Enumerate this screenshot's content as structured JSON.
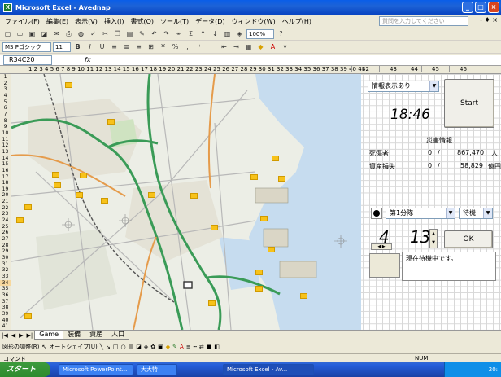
{
  "window": {
    "title": "Microsoft Excel - Avednap",
    "app_icon": "X"
  },
  "menu": {
    "items": [
      "ファイル(F)",
      "編集(E)",
      "表示(V)",
      "挿入(I)",
      "書式(O)",
      "ツール(T)",
      "データ(D)",
      "ウィンドウ(W)",
      "ヘルプ(H)"
    ],
    "help_placeholder": "質問を入力してください",
    "mdi": "- ♦ ×"
  },
  "toolbar": {
    "zoom": "100%",
    "font_name": "MS Pゴシック",
    "font_size": "11"
  },
  "namebox": {
    "cell": "R34C20",
    "fx": "fx"
  },
  "columns": {
    "narrow_numbers": "1 2 3 4 5 6 7 8 9 10 11 12 13 14 15 16 17 18 19 20 21 22 23 24 25 26 27 28 29 30 31 32 33 34 35 36 37 38 39 40 41",
    "wide": [
      "42",
      "43",
      "44",
      "45",
      "46"
    ]
  },
  "rows": [
    "1",
    "2",
    "3",
    "4",
    "5",
    "6",
    "7",
    "8",
    "9",
    "10",
    "11",
    "12",
    "13",
    "14",
    "15",
    "16",
    "17",
    "18",
    "19",
    "20",
    "21",
    "22",
    "23",
    "24",
    "25",
    "26",
    "27",
    "28",
    "29",
    "30",
    "31",
    "32",
    "33",
    "34",
    "35",
    "36",
    "37",
    "38",
    "39",
    "40",
    "41"
  ],
  "panel": {
    "info_select": "情報表示あり",
    "clock": "18:46",
    "start_button": "Start",
    "disaster_header": "災害情報",
    "casualty_label": "死傷者",
    "casualty_current": "0",
    "casualty_sep": "/",
    "casualty_total": "867,470",
    "casualty_unit": "人",
    "loss_label": "資産損失",
    "loss_current": "0",
    "loss_sep": "/",
    "loss_total": "58,829",
    "loss_unit": "億円",
    "unit_select": "第1分隊",
    "mode_select": "待機",
    "num_left": "4",
    "num_right": "13",
    "ok_button": "OK",
    "message": "現在待機中です。"
  },
  "sheet_tabs": [
    "Game",
    "装備",
    "資産",
    "人口"
  ],
  "drawbar": {
    "adjust": "図形の調整(R)",
    "autoshape": "オートシェイプ(U)"
  },
  "status": {
    "left": "コマンド",
    "right": "NUM"
  },
  "taskbar": {
    "start": "スタート",
    "tasks": [
      "Microsoft PowerPoint...",
      "大大特",
      "Microsoft Excel - Av..."
    ],
    "tray": "20:"
  },
  "colors": {
    "marker": "#f7c21a",
    "road_green": "#3a9b57",
    "titlebar": "#0a5ee8",
    "water": "#b9d3ea"
  }
}
